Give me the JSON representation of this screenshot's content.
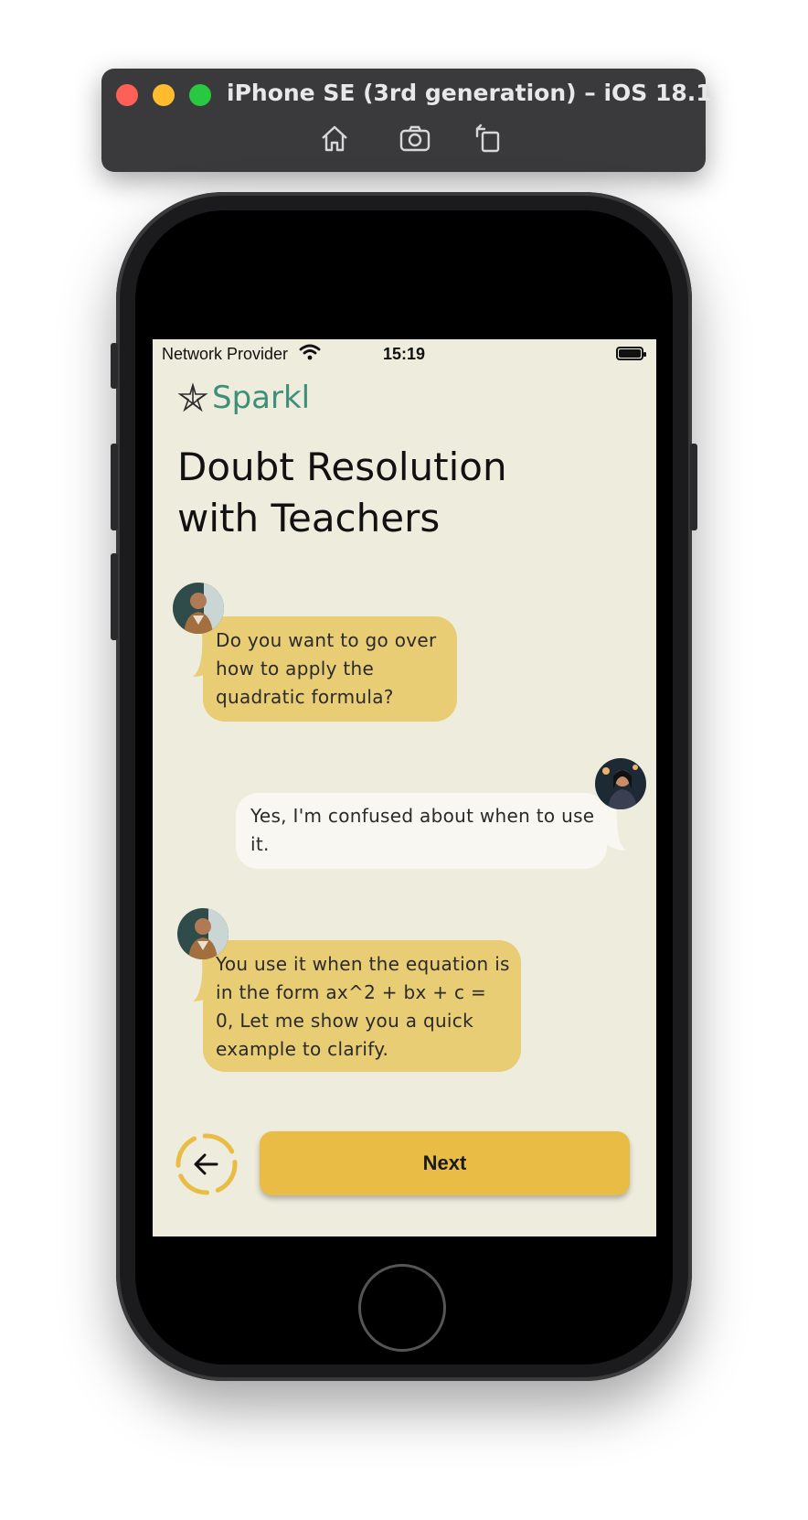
{
  "simulator": {
    "title": "iPhone SE (3rd generation) – iOS 18.1",
    "tools": [
      "home-icon",
      "screenshot-icon",
      "rotate-icon"
    ]
  },
  "status_bar": {
    "provider": "Network Provider",
    "time": "15:19"
  },
  "app": {
    "brand": "Sparkl",
    "brand_color": "#3d8f78",
    "title_line1": "Doubt Resolution",
    "title_line2": "with Teachers"
  },
  "chat": [
    {
      "sender": "teacher",
      "text": "Do you want to go over how to apply the quadratic formula?"
    },
    {
      "sender": "student",
      "text": "Yes, I'm confused about when to use it."
    },
    {
      "sender": "teacher",
      "text": "You use it when the equation is in the form ax^2 + bx + c = 0, Let me show you a quick example to clarify."
    }
  ],
  "footer": {
    "next_label": "Next",
    "accent": "#e9bd45"
  },
  "colors": {
    "screen_bg": "#eeecdd",
    "teacher_bubble": "#e9cd74",
    "student_bubble": "#f8f7f1"
  }
}
